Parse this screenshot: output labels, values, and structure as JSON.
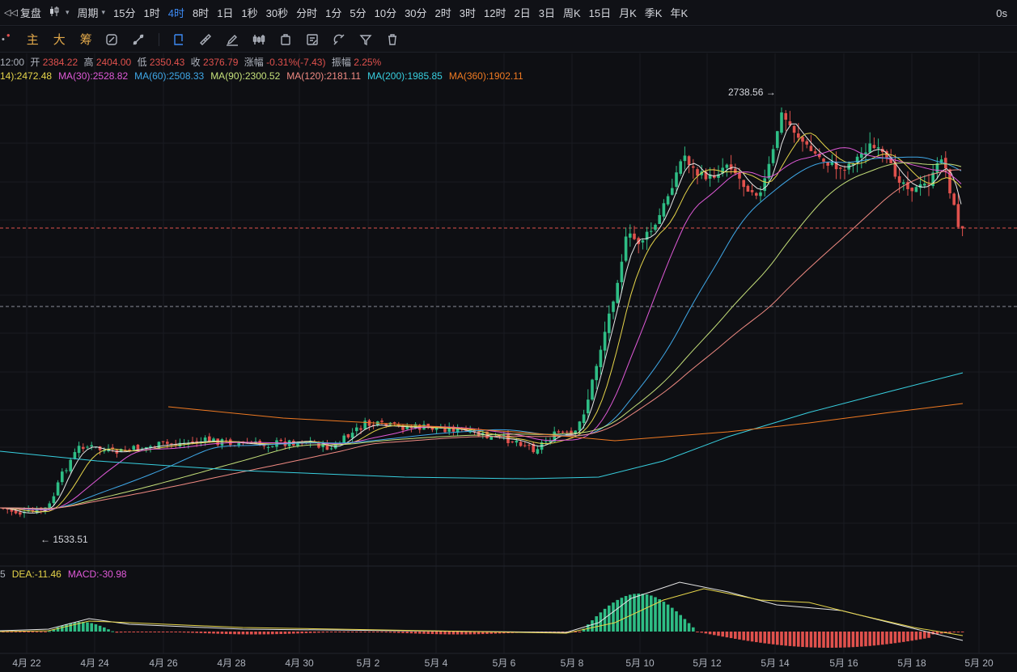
{
  "topbar": {
    "replay": "复盘",
    "period": "周期",
    "intervals": [
      "15分",
      "1时",
      "4时",
      "8时",
      "1日",
      "1秒",
      "30秒",
      "分时",
      "1分",
      "5分",
      "10分",
      "30分",
      "2时",
      "3时",
      "12时",
      "2日",
      "3日",
      "周K",
      "15日",
      "月K",
      "季K",
      "年K"
    ],
    "active_interval": "4时",
    "latency": "0s"
  },
  "toolbar2": {
    "indicator_main": "主",
    "indicator_big": "大",
    "indicator_chips": "筹",
    "tools": [
      "drawing-tool-icon",
      "ruler-icon",
      "pen-icon",
      "indicator-icon",
      "copy-icon",
      "note-icon",
      "magnet-icon",
      "filter-icon",
      "trash-icon"
    ]
  },
  "ohlc": {
    "time": "12:00",
    "open_label": "开",
    "open": "2384.22",
    "high_label": "高",
    "high": "2404.00",
    "low_label": "低",
    "low": "2350.43",
    "close_label": "收",
    "close": "2376.79",
    "change_label": "涨幅",
    "change": "-0.31%(-7.43)",
    "amplitude_label": "振幅",
    "amplitude": "2.25%"
  },
  "ma_line": [
    {
      "text": "14):2472.48",
      "color": "#e6d54a"
    },
    {
      "text": "MA(30):2528.82",
      "color": "#e05ad8"
    },
    {
      "text": "MA(60):2508.33",
      "color": "#3fa8e8"
    },
    {
      "text": "MA(90):2300.52",
      "color": "#c5e07a"
    },
    {
      "text": "MA(120):2181.11",
      "color": "#f08a82"
    },
    {
      "text": "MA(200):1985.85",
      "color": "#38d0e0"
    },
    {
      "text": "MA(360):1902.11",
      "color": "#f07a22"
    }
  ],
  "macd_line": [
    {
      "text": "5",
      "color": "#aeb3bd"
    },
    {
      "text": "DEA:-11.46",
      "color": "#e6d54a"
    },
    {
      "text": "MACD:-30.98",
      "color": "#e05ad8"
    }
  ],
  "annotations": {
    "high_price": "2738.56",
    "low_price": "1533.51"
  },
  "x_axis": [
    "4月 22",
    "4月 24",
    "4月 26",
    "4月 28",
    "4月 30",
    "5月 2",
    "5月 4",
    "5月 6",
    "5月 8",
    "5月 10",
    "5月 12",
    "5月 14",
    "5月 16",
    "5月 18",
    "5月 20"
  ],
  "colors": {
    "up": "#2ebd85",
    "down": "#e0514d",
    "accent": "#3d8bf5"
  }
}
